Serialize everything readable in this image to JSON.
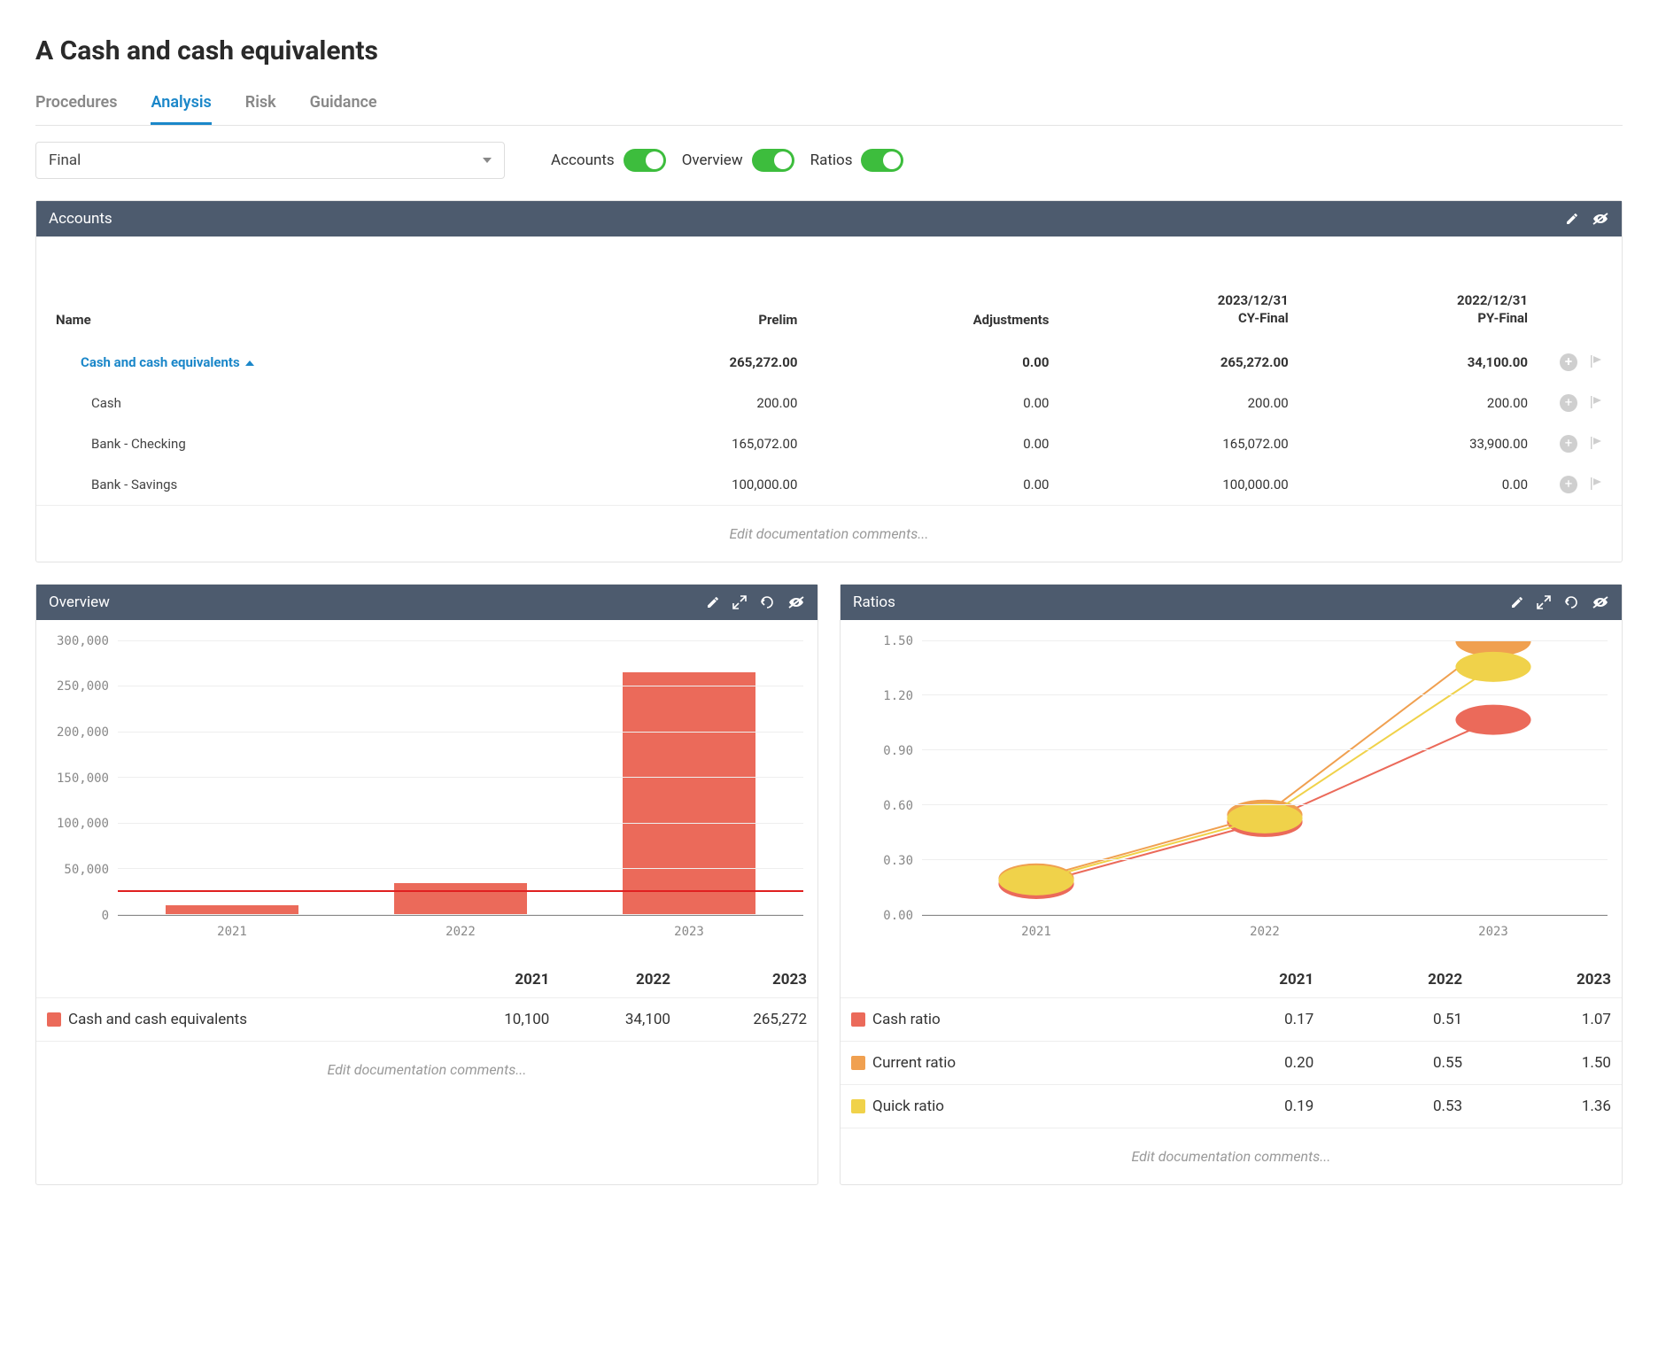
{
  "page_title": "A Cash and cash equivalents",
  "tabs": [
    {
      "label": "Procedures",
      "active": false
    },
    {
      "label": "Analysis",
      "active": true
    },
    {
      "label": "Risk",
      "active": false
    },
    {
      "label": "Guidance",
      "active": false
    }
  ],
  "dropdown": {
    "selected": "Final"
  },
  "toggles": [
    {
      "label": "Accounts",
      "on": true
    },
    {
      "label": "Overview",
      "on": true
    },
    {
      "label": "Ratios",
      "on": true
    }
  ],
  "accounts": {
    "title": "Accounts",
    "columns": {
      "name": "Name",
      "prelim": "Prelim",
      "adjustments": "Adjustments",
      "cy_date": "2023/12/31",
      "cy_label": "CY-Final",
      "py_date": "2022/12/31",
      "py_label": "PY-Final"
    },
    "rows": [
      {
        "type": "parent",
        "name": "Cash and cash equivalents",
        "prelim": "265,272.00",
        "adjustments": "0.00",
        "cy": "265,272.00",
        "py": "34,100.00"
      },
      {
        "type": "child",
        "name": "Cash",
        "prelim": "200.00",
        "adjustments": "0.00",
        "cy": "200.00",
        "py": "200.00"
      },
      {
        "type": "child",
        "name": "Bank - Checking",
        "prelim": "165,072.00",
        "adjustments": "0.00",
        "cy": "165,072.00",
        "py": "33,900.00"
      },
      {
        "type": "child",
        "name": "Bank - Savings",
        "prelim": "100,000.00",
        "adjustments": "0.00",
        "cy": "100,000.00",
        "py": "0.00"
      }
    ],
    "edit_comments": "Edit documentation comments..."
  },
  "overview": {
    "title": "Overview",
    "edit_comments": "Edit documentation comments...",
    "series_name": "Cash and cash equivalents",
    "years": [
      "2021",
      "2022",
      "2023"
    ],
    "values_display": [
      "10,100",
      "34,100",
      "265,272"
    ]
  },
  "ratios": {
    "title": "Ratios",
    "edit_comments": "Edit documentation comments...",
    "years": [
      "2021",
      "2022",
      "2023"
    ],
    "series": [
      {
        "name": "Cash ratio",
        "color_class": "sw-cash",
        "values": [
          "0.17",
          "0.51",
          "1.07"
        ]
      },
      {
        "name": "Current ratio",
        "color_class": "sw-curr",
        "values": [
          "0.20",
          "0.55",
          "1.50"
        ]
      },
      {
        "name": "Quick ratio",
        "color_class": "sw-quick",
        "values": [
          "0.19",
          "0.53",
          "1.36"
        ]
      }
    ]
  },
  "chart_data": [
    {
      "type": "bar",
      "title": "Overview",
      "categories": [
        "2021",
        "2022",
        "2023"
      ],
      "series": [
        {
          "name": "Cash and cash equivalents",
          "values": [
            10100,
            34100,
            265272
          ]
        }
      ],
      "ylim": [
        0,
        300000
      ],
      "y_ticks": [
        0,
        50000,
        100000,
        150000,
        200000,
        250000,
        300000
      ],
      "y_tick_labels": [
        "0",
        "50,000",
        "100,000",
        "150,000",
        "200,000",
        "250,000",
        "300,000"
      ],
      "reference_line": 25000
    },
    {
      "type": "line",
      "title": "Ratios",
      "categories": [
        "2021",
        "2022",
        "2023"
      ],
      "series": [
        {
          "name": "Cash ratio",
          "values": [
            0.17,
            0.51,
            1.07
          ]
        },
        {
          "name": "Current ratio",
          "values": [
            0.2,
            0.55,
            1.5
          ]
        },
        {
          "name": "Quick ratio",
          "values": [
            0.19,
            0.53,
            1.36
          ]
        }
      ],
      "ylim": [
        0.0,
        1.5
      ],
      "y_ticks": [
        0.0,
        0.3,
        0.6,
        0.9,
        1.2,
        1.5
      ],
      "y_tick_labels": [
        "0.00",
        "0.30",
        "0.60",
        "0.90",
        "1.20",
        "1.50"
      ]
    }
  ]
}
